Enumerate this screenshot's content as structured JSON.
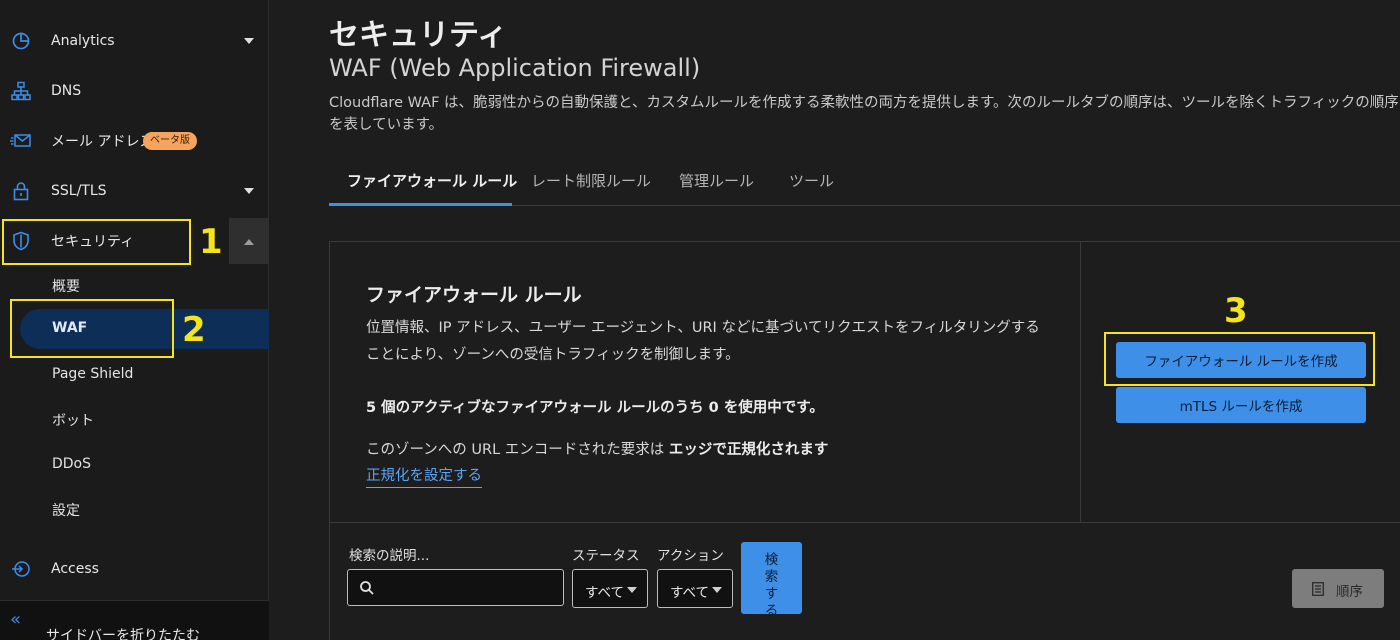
{
  "sidebar": {
    "nav": [
      {
        "label": "Analytics",
        "icon": "pie-chart-icon"
      },
      {
        "label": "DNS",
        "icon": "dns-network-icon"
      },
      {
        "label": "メール アドレス",
        "icon": "mail-icon",
        "badge": "ベータ版"
      },
      {
        "label": "SSL/TLS",
        "icon": "lock-icon"
      },
      {
        "label": "セキュリティ",
        "icon": "shield-icon"
      },
      {
        "label": "Access",
        "icon": "access-icon"
      }
    ],
    "security_sub": [
      "概要",
      "WAF",
      "Page Shield",
      "ボット",
      "DDoS",
      "設定"
    ],
    "collapse_label": "サイドバーを折りたたむ"
  },
  "annotations": {
    "one": "1",
    "two": "2",
    "three": "3"
  },
  "header": {
    "title": "セキュリティ",
    "subtitle": "WAF (Web Application Firewall)",
    "description": "Cloudflare WAF は、脆弱性からの自動保護と、カスタムルールを作成する柔軟性の両方を提供します。次のルールタブの順序は、ツールを除くトラフィックの順序を表しています。"
  },
  "tabs": [
    "ファイアウォール ルール",
    "レート制限ルール",
    "管理ルール",
    "ツール"
  ],
  "card": {
    "title": "ファイアウォール ルール",
    "description": "位置情報、IP アドレス、ユーザー エージェント、URI などに基づいてリクエストをフィルタリングすることにより、ゾーンへの受信トラフィックを制御します。",
    "usage": "5 個のアクティブなファイアウォール ルールのうち 0 を使用中です。",
    "normalize_prefix": "このゾーンへの URL エンコードされた要求は ",
    "normalize_bold": "エッジで正規化されます",
    "normalize_link": "正規化を設定する",
    "create_firewall_rule": "ファイアウォール ルールを作成",
    "create_mtls_rule": "mTLS ルールを作成"
  },
  "filters": {
    "search_label": "検索の説明...",
    "search_value": "",
    "status_label": "ステータス",
    "status_value": "すべて",
    "action_label": "アクション",
    "action_value": "すべて",
    "search_button": "検索する",
    "order_button": "順序"
  },
  "colors": {
    "accent": "#3d8fe8",
    "annotation": "#f4e41c",
    "beta_badge": "#f6a45d",
    "active_nav_bg": "#0d2e57"
  }
}
